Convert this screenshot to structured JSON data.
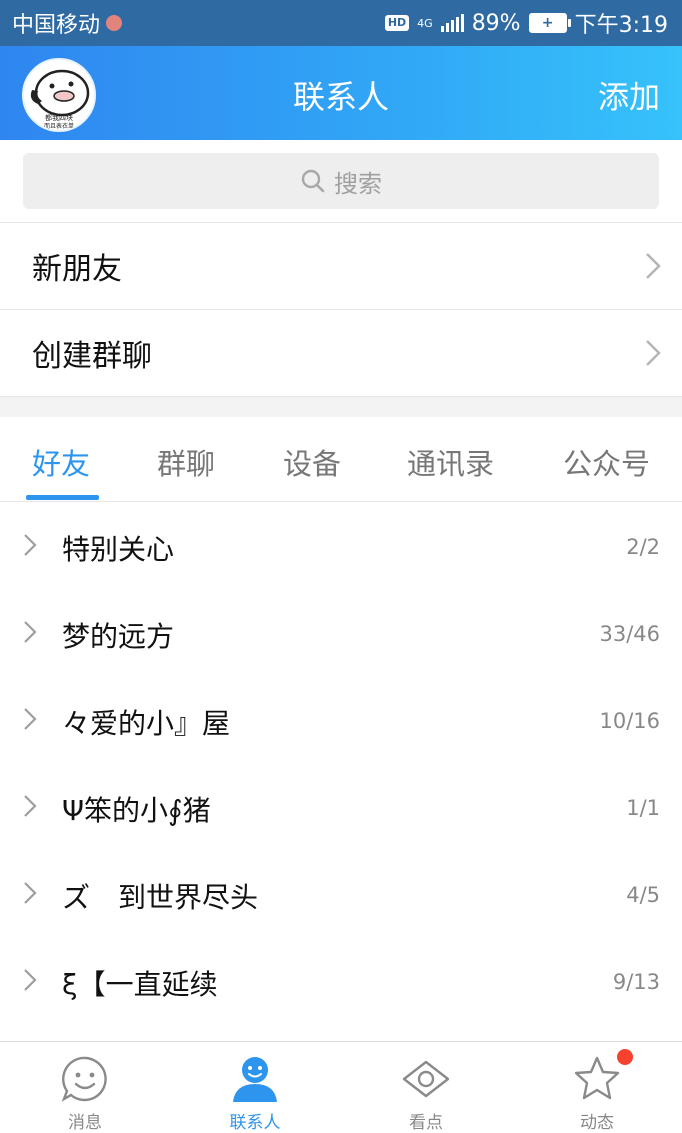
{
  "status_bar": {
    "carrier": "中国移动",
    "network": "4G",
    "hd_label": "HD",
    "battery": "89%",
    "time": "下午3:19"
  },
  "header": {
    "title": "联系人",
    "add_label": "添加",
    "avatar_icon": "cartoon-avatar-icon",
    "avatar_caption_1": "都我四块",
    "avatar_caption_2": "而且表衣单"
  },
  "search": {
    "placeholder": "搜索",
    "icon": "search-icon"
  },
  "menu": [
    {
      "label": "新朋友"
    },
    {
      "label": "创建群聊"
    }
  ],
  "tabs": [
    {
      "label": "好友",
      "active": true
    },
    {
      "label": "群聊",
      "active": false
    },
    {
      "label": "设备",
      "active": false
    },
    {
      "label": "通讯录",
      "active": false
    },
    {
      "label": "公众号",
      "active": false
    }
  ],
  "groups": [
    {
      "name": "特别关心",
      "count": "2/2"
    },
    {
      "name": "梦的远方",
      "count": "33/46"
    },
    {
      "name": "々爱的小』屋",
      "count": "10/16"
    },
    {
      "name": "Ψ笨的小∮猪",
      "count": "1/1"
    },
    {
      "name": "ズ　到世界尽头",
      "count": "4/5"
    },
    {
      "name": "ξ【一直延续",
      "count": "9/13"
    }
  ],
  "bottom_nav": [
    {
      "label": "消息",
      "icon": "smiley-bubble-icon",
      "active": false
    },
    {
      "label": "联系人",
      "icon": "person-icon",
      "active": true
    },
    {
      "label": "看点",
      "icon": "eye-icon",
      "active": false
    },
    {
      "label": "动态",
      "icon": "star-icon",
      "active": false,
      "has_badge": true
    }
  ],
  "colors": {
    "accent": "#2e95ee",
    "header_start": "#2f86f0",
    "header_end": "#36c2fb",
    "status_bar": "#2f6aa3",
    "badge": "#f5412d"
  }
}
